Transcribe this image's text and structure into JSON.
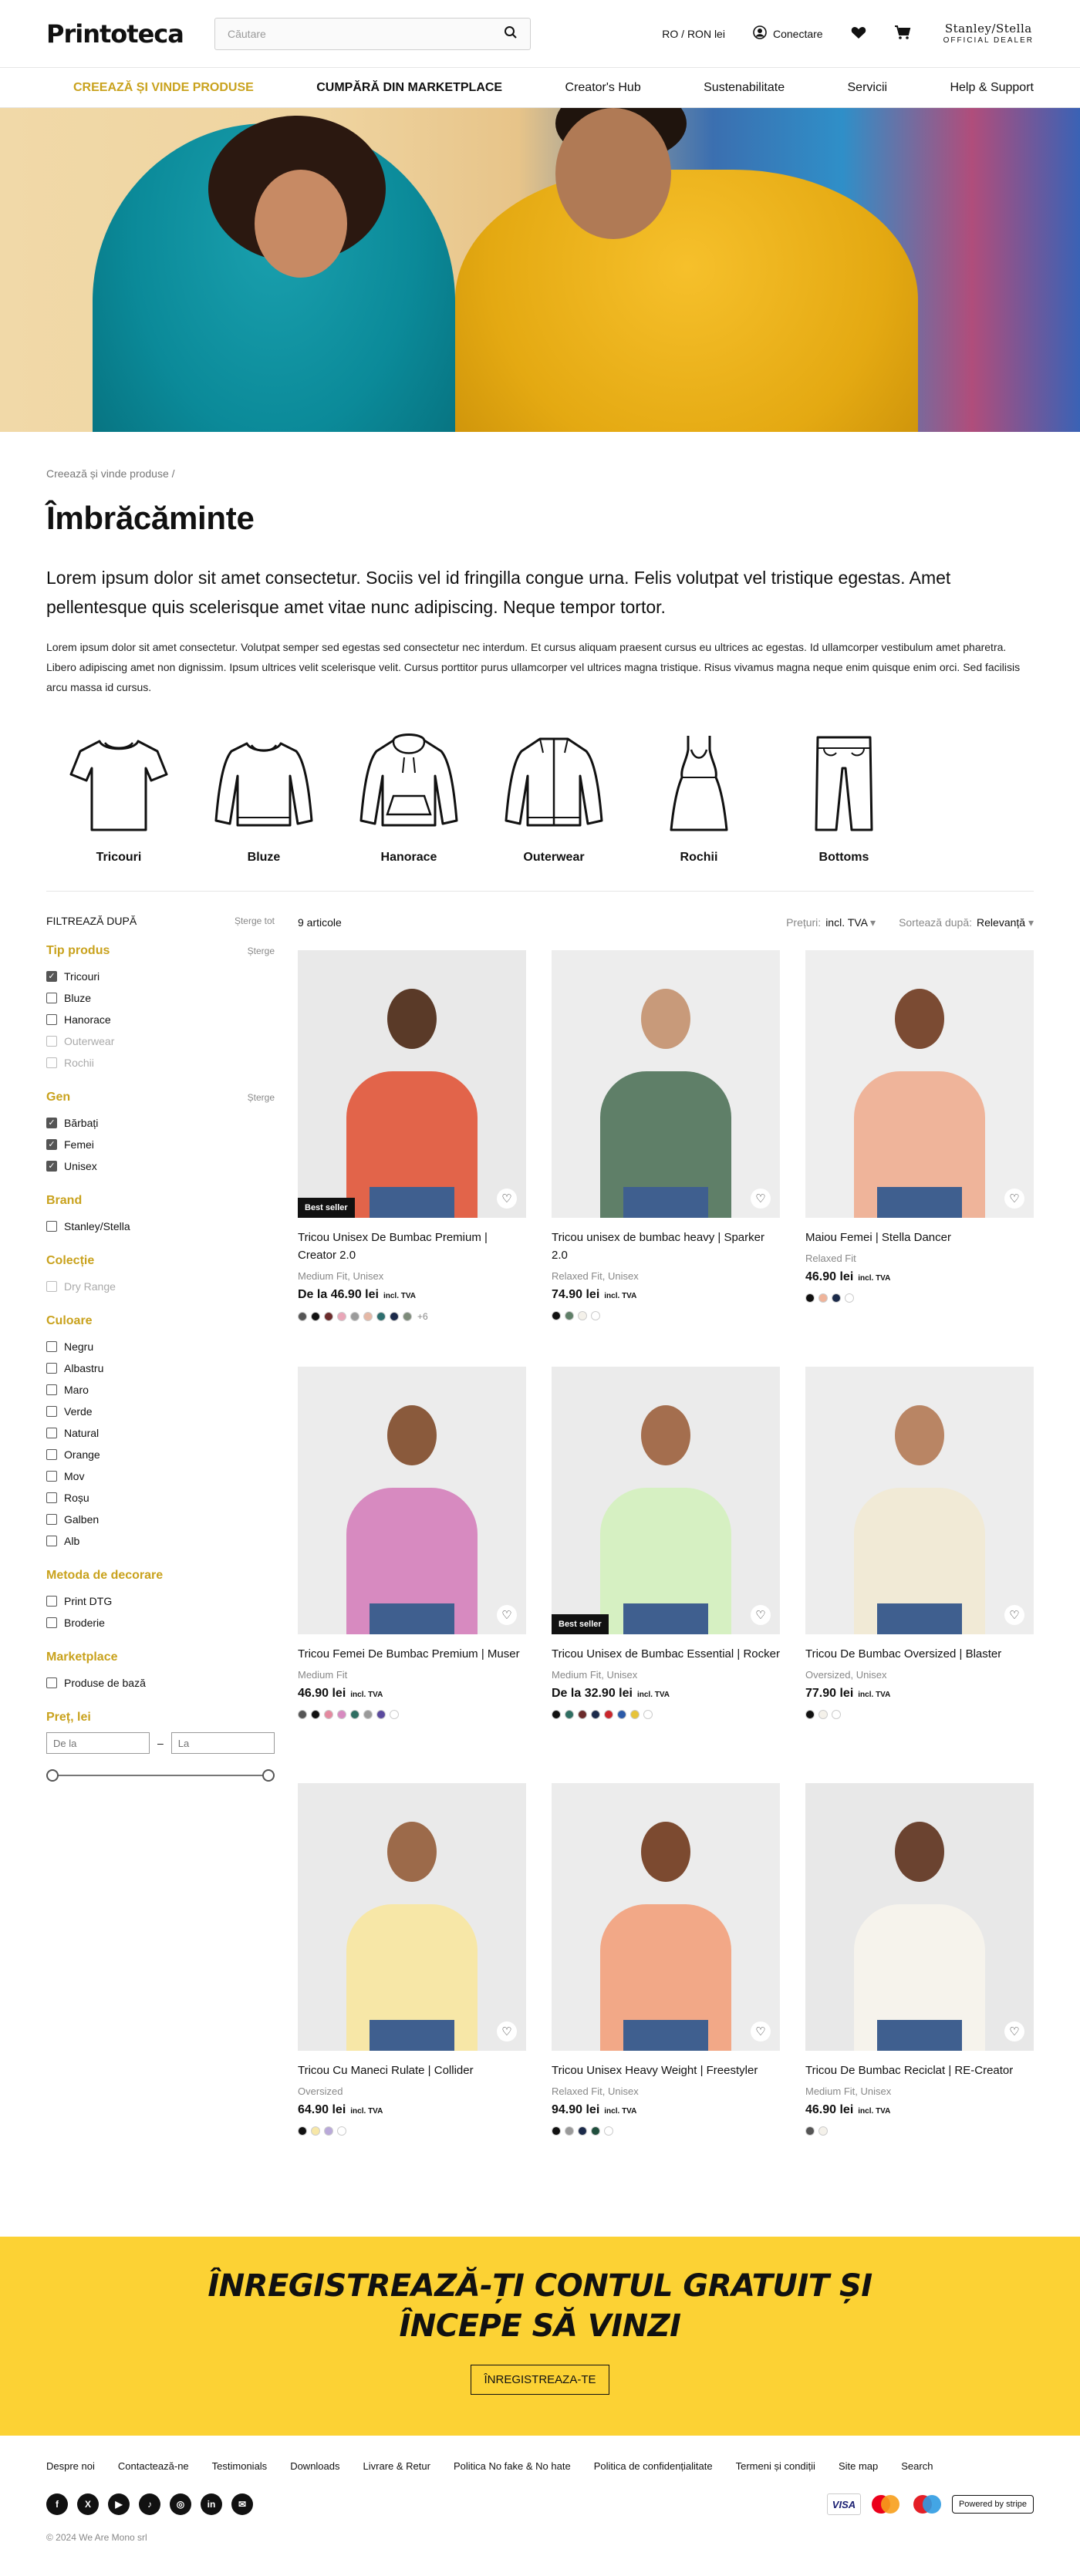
{
  "header": {
    "logo": "Printoteca",
    "search_placeholder": "Căutare",
    "locale": "RO / RON lei",
    "login": "Conectare",
    "dealer_brand": "Stanley/Stella",
    "dealer_sub": "OFFICIAL DEALER"
  },
  "nav": [
    {
      "label": "Creează și vinde produse"
    },
    {
      "label": "Cumpără din marketplace"
    },
    {
      "label": "Creator's Hub"
    },
    {
      "label": "Sustenabilitate"
    },
    {
      "label": "Servicii"
    },
    {
      "label": "Help & Support"
    }
  ],
  "breadcrumb": "Creează și vinde produse  /",
  "page_title": "Îmbrăcăminte",
  "lead": "Lorem ipsum dolor sit amet consectetur. Sociis vel id fringilla congue urna. Felis volutpat vel tristique egestas. Amet pellentesque quis scelerisque amet vitae nunc adipiscing. Neque tempor tortor.",
  "body_text": "Lorem ipsum dolor sit amet consectetur. Volutpat semper sed egestas sed consectetur nec interdum. Et cursus aliquam praesent cursus eu ultrices ac egestas. Id ullamcorper vestibulum amet pharetra. Libero adipiscing amet non dignissim. Ipsum ultrices velit scelerisque velit. Cursus porttitor purus ullamcorper vel ultrices magna tristique. Risus vivamus magna neque enim quisque enim orci. Sed facilisis arcu massa id cursus.",
  "categories": [
    {
      "label": "Tricouri",
      "icon": "tshirt-icon"
    },
    {
      "label": "Bluze",
      "icon": "sweatshirt-icon"
    },
    {
      "label": "Hanorace",
      "icon": "hoodie-icon"
    },
    {
      "label": "Outerwear",
      "icon": "jacket-icon"
    },
    {
      "label": "Rochii",
      "icon": "dress-icon"
    },
    {
      "label": "Bottoms",
      "icon": "pants-icon"
    }
  ],
  "filters": {
    "title": "FILTREAZĂ DUPĂ",
    "clear_all": "Șterge tot",
    "clear": "Șterge",
    "tip_produs": {
      "title": "Tip produs",
      "options": [
        {
          "label": "Tricouri",
          "checked": true,
          "disabled": false
        },
        {
          "label": "Bluze",
          "checked": false,
          "disabled": false
        },
        {
          "label": "Hanorace",
          "checked": false,
          "disabled": false
        },
        {
          "label": "Outerwear",
          "checked": false,
          "disabled": true
        },
        {
          "label": "Rochii",
          "checked": false,
          "disabled": true
        }
      ]
    },
    "gen": {
      "title": "Gen",
      "options": [
        {
          "label": "Bărbați",
          "checked": true,
          "disabled": false
        },
        {
          "label": "Femei",
          "checked": true,
          "disabled": false
        },
        {
          "label": "Unisex",
          "checked": true,
          "disabled": false
        }
      ]
    },
    "brand": {
      "title": "Brand",
      "options": [
        {
          "label": "Stanley/Stella",
          "checked": false,
          "disabled": false
        }
      ]
    },
    "colectie": {
      "title": "Colecție",
      "options": [
        {
          "label": "Dry Range",
          "checked": false,
          "disabled": true
        }
      ]
    },
    "culoare": {
      "title": "Culoare",
      "options": [
        {
          "label": "Negru",
          "checked": false,
          "disabled": false
        },
        {
          "label": "Albastru",
          "checked": false,
          "disabled": false
        },
        {
          "label": "Maro",
          "checked": false,
          "disabled": false
        },
        {
          "label": "Verde",
          "checked": false,
          "disabled": false
        },
        {
          "label": "Natural",
          "checked": false,
          "disabled": false
        },
        {
          "label": "Orange",
          "checked": false,
          "disabled": false
        },
        {
          "label": "Mov",
          "checked": false,
          "disabled": false
        },
        {
          "label": "Roșu",
          "checked": false,
          "disabled": false
        },
        {
          "label": "Galben",
          "checked": false,
          "disabled": false
        },
        {
          "label": "Alb",
          "checked": false,
          "disabled": false
        }
      ]
    },
    "metoda": {
      "title": "Metoda de decorare",
      "options": [
        {
          "label": "Print DTG",
          "checked": false,
          "disabled": false
        },
        {
          "label": "Broderie",
          "checked": false,
          "disabled": false
        }
      ]
    },
    "marketplace": {
      "title": "Marketplace",
      "options": [
        {
          "label": "Produse de bază",
          "checked": false,
          "disabled": false
        }
      ]
    },
    "pret": {
      "title": "Preț, lei",
      "from_placeholder": "De la",
      "to_placeholder": "La",
      "separator": "–"
    }
  },
  "toolbar": {
    "count": "9 articole",
    "prices_label": "Prețuri:",
    "prices_value": "incl. TVA",
    "sort_label": "Sortează după:",
    "sort_value": "Relevanță"
  },
  "accent_color": "#c9a21d",
  "products": [
    {
      "name": "Tricou Unisex De Bumbac Premium | Creator 2.0",
      "fit": "Medium Fit, Unisex",
      "price": "De la 46.90 lei",
      "vat": "incl. TVA",
      "badge": "Best seller",
      "bg": "#e9e9e9",
      "shirt": "#e2644a",
      "skin": "#5a3a28",
      "colors": [
        "#555555",
        "#111111",
        "#6b2b2b",
        "#e9a6b8",
        "#9a9a9a",
        "#e5b8a6",
        "#2d6e6e",
        "#1b2a4a",
        "#7d8b7a"
      ],
      "more": "+6"
    },
    {
      "name": "Tricou unisex de bumbac heavy | Sparker 2.0",
      "fit": "Relaxed Fit, Unisex",
      "price": "74.90 lei",
      "vat": "incl. TVA",
      "badge": "",
      "bg": "#ededed",
      "shirt": "#5f7f68",
      "skin": "#c89a7a",
      "colors": [
        "#111111",
        "#5f7f68",
        "#f4f1ea",
        "#ffffff"
      ],
      "more": ""
    },
    {
      "name": "Maiou Femei | Stella Dancer",
      "fit": "Relaxed Fit",
      "price": "46.90 lei",
      "vat": "incl. TVA",
      "badge": "",
      "bg": "#eeeeee",
      "shirt": "#efb49a",
      "skin": "#7b4b33",
      "colors": [
        "#111111",
        "#efb49a",
        "#1b2a4a",
        "#ffffff"
      ],
      "more": ""
    },
    {
      "name": "Tricou Femei De Bumbac Premium | Muser",
      "fit": "Medium Fit",
      "price": "46.90 lei",
      "vat": "incl. TVA",
      "badge": "",
      "bg": "#ececec",
      "shirt": "#d78ac0",
      "skin": "#8a5a3c",
      "colors": [
        "#555555",
        "#111111",
        "#e48aa0",
        "#d78ac0",
        "#2f6e62",
        "#9a9a9a",
        "#5b4a9e",
        "#ffffff"
      ],
      "more": ""
    },
    {
      "name": "Tricou Unisex de Bumbac Essential | Rocker",
      "fit": "Medium Fit, Unisex",
      "price": "De la 32.90 lei",
      "vat": "incl. TVA",
      "badge": "Best seller",
      "bg": "#ebebeb",
      "shirt": "#d6f0c2",
      "skin": "#a46e4e",
      "colors": [
        "#111111",
        "#2f6e62",
        "#6b2b2b",
        "#1b2a4a",
        "#c9262c",
        "#2b5aa8",
        "#e6c33a",
        "#ffffff"
      ],
      "more": ""
    },
    {
      "name": "Tricou De Bumbac Oversized | Blaster",
      "fit": "Oversized, Unisex",
      "price": "77.90 lei",
      "vat": "incl. TVA",
      "badge": "",
      "bg": "#ededed",
      "shirt": "#f1ead6",
      "skin": "#b98564",
      "colors": [
        "#111111",
        "#f4f1ea",
        "#ffffff"
      ],
      "more": ""
    },
    {
      "name": "Tricou Cu Maneci Rulate | Collider",
      "fit": "Oversized",
      "price": "64.90 lei",
      "vat": "incl. TVA",
      "badge": "",
      "bg": "#eaeaea",
      "shirt": "#f7e7a7",
      "skin": "#9c6a4a",
      "colors": [
        "#111111",
        "#f7e7a7",
        "#b9a9d9",
        "#ffffff"
      ],
      "more": ""
    },
    {
      "name": "Tricou Unisex Heavy Weight | Freestyler",
      "fit": "Relaxed Fit, Unisex",
      "price": "94.90 lei",
      "vat": "incl. TVA",
      "badge": "",
      "bg": "#ececec",
      "shirt": "#f2a887",
      "skin": "#7c4a30",
      "colors": [
        "#111111",
        "#9a9a9a",
        "#1b2a4a",
        "#1f4e3d",
        "#ffffff"
      ],
      "more": ""
    },
    {
      "name": "Tricou De Bumbac Reciclat | RE-Creator",
      "fit": "Medium Fit, Unisex",
      "price": "46.90 lei",
      "vat": "incl. TVA",
      "badge": "",
      "bg": "#e8e8e8",
      "shirt": "#f6f3ec",
      "skin": "#6b4330",
      "colors": [
        "#555555",
        "#f4f1ea"
      ],
      "more": ""
    }
  ],
  "cta": {
    "line1": "ÎNREGISTREAZĂ-ȚI CONTUL GRATUIT ȘI",
    "line2": "ÎNCEPE SĂ VINZI",
    "button": "ÎNREGISTREAZA-TE",
    "bg": "#fcd234"
  },
  "footer": {
    "links": [
      "Despre noi",
      "Contactează-ne",
      "Testimonials",
      "Downloads",
      "Livrare & Retur",
      "Politica No fake & No hate",
      "Politica de confidențialitate",
      "Termeni și condiții",
      "Site map",
      "Search"
    ],
    "socials": [
      {
        "icon": "facebook-icon",
        "glyph": "f"
      },
      {
        "icon": "x-icon",
        "glyph": "X"
      },
      {
        "icon": "youtube-icon",
        "glyph": "▶"
      },
      {
        "icon": "tiktok-icon",
        "glyph": "♪"
      },
      {
        "icon": "instagram-icon",
        "glyph": "◎"
      },
      {
        "icon": "linkedin-icon",
        "glyph": "in"
      },
      {
        "icon": "email-icon",
        "glyph": "✉"
      }
    ],
    "visa": "VISA",
    "stripe": "Powered by stripe",
    "copyright": "© 2024  We Are Mono srl"
  }
}
